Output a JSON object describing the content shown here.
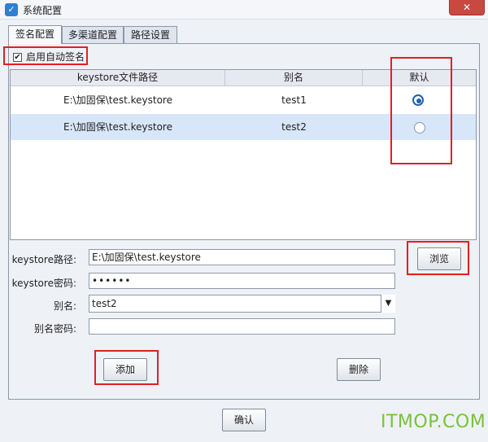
{
  "window": {
    "title": "系统配置",
    "close_label": "✕"
  },
  "tabs": [
    {
      "label": "签名配置",
      "active": true
    },
    {
      "label": "多渠道配置",
      "active": false
    },
    {
      "label": "路径设置",
      "active": false
    }
  ],
  "auto_sign": {
    "label": "启用自动签名",
    "checked": true
  },
  "table": {
    "columns": [
      "keystore文件路径",
      "别名",
      "默认"
    ],
    "rows": [
      {
        "path": "E:\\加固保\\test.keystore",
        "alias": "test1",
        "default": true
      },
      {
        "path": "E:\\加固保\\test.keystore",
        "alias": "test2",
        "default": false
      }
    ]
  },
  "form": {
    "keystore_path_label": "keystore路径:",
    "keystore_path_value": "E:\\加固保\\test.keystore",
    "browse_label": "浏览",
    "keystore_password_label": "keystore密码:",
    "keystore_password_value": "••••••",
    "alias_label": "别名:",
    "alias_value": "test2",
    "alias_password_label": "别名密码:",
    "alias_password_value": ""
  },
  "buttons": {
    "add": "添加",
    "delete": "删除",
    "confirm": "确认"
  },
  "watermark": "ITMOP.COM",
  "colors": {
    "highlight_box": "#e02020",
    "selected_row": "#d7e6f8",
    "watermark": "#78c23a"
  }
}
